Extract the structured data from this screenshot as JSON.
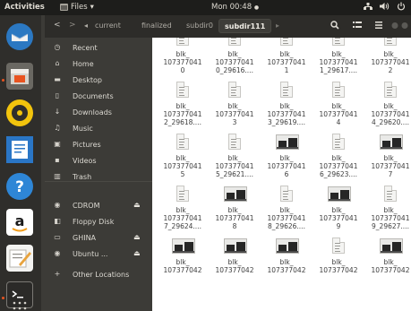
{
  "topbar": {
    "activities": "Activities",
    "app_menu": "Files",
    "app_menu_caret": "▾",
    "clock": "Mon 00:48",
    "clock_dot": "●",
    "tray": [
      "network-icon",
      "volume-icon",
      "power-icon"
    ]
  },
  "dock": {
    "items": [
      "thunderbird-icon",
      "files-icon",
      "rhythmbox-icon",
      "writer-icon",
      "help-icon",
      "amazon-icon",
      "text-editor-icon",
      "terminal-icon",
      "app-grid-icon"
    ]
  },
  "headerbar": {
    "back": "<",
    "forward": ">",
    "breadcrumb_left": "◂",
    "breadcrumbs": [
      "current",
      "finalized",
      "subdir0",
      "subdir111"
    ],
    "breadcrumb_right": "▸",
    "icons": [
      "search-icon",
      "list-view-icon",
      "menu-icon"
    ]
  },
  "sidebar": {
    "items": [
      {
        "label": "Recent",
        "icon": "recent-icon",
        "glyph": "◷"
      },
      {
        "label": "Home",
        "icon": "home-icon",
        "glyph": "⌂"
      },
      {
        "label": "Desktop",
        "icon": "desktop-icon",
        "glyph": "▬"
      },
      {
        "label": "Documents",
        "icon": "documents-icon",
        "glyph": "▯"
      },
      {
        "label": "Downloads",
        "icon": "downloads-icon",
        "glyph": "↓"
      },
      {
        "label": "Music",
        "icon": "music-icon",
        "glyph": "♫"
      },
      {
        "label": "Pictures",
        "icon": "pictures-icon",
        "glyph": "▣"
      },
      {
        "label": "Videos",
        "icon": "videos-icon",
        "glyph": "▪"
      },
      {
        "label": "Trash",
        "icon": "trash-icon",
        "glyph": "▥"
      },
      {
        "label": "CDROM",
        "icon": "cdrom-icon",
        "glyph": "◉",
        "eject": "⏏"
      },
      {
        "label": "Floppy Disk",
        "icon": "floppy-icon",
        "glyph": "◧"
      },
      {
        "label": "GHINA",
        "icon": "drive-icon",
        "glyph": "▭",
        "eject": "⏏"
      },
      {
        "label": "Ubuntu ...",
        "icon": "disc-icon",
        "glyph": "◉",
        "eject": "⏏"
      },
      {
        "label": "Other Locations",
        "icon": "plus-icon",
        "glyph": "+"
      }
    ]
  },
  "files": [
    {
      "l1": "blk_",
      "l2": "107377041",
      "l3": "0",
      "kind": "doc"
    },
    {
      "l1": "blk_",
      "l2": "107377041",
      "l3": "0_29616....",
      "kind": "doc"
    },
    {
      "l1": "blk_",
      "l2": "107377041",
      "l3": "1",
      "kind": "doc"
    },
    {
      "l1": "blk_",
      "l2": "107377041",
      "l3": "1_29617....",
      "kind": "doc"
    },
    {
      "l1": "blk_",
      "l2": "107377041",
      "l3": "2",
      "kind": "doc"
    },
    {
      "l1": "blk_",
      "l2": "107377041",
      "l3": "2_29618....",
      "kind": "doc"
    },
    {
      "l1": "blk_",
      "l2": "107377041",
      "l3": "3",
      "kind": "doc"
    },
    {
      "l1": "blk_",
      "l2": "107377041",
      "l3": "3_29619....",
      "kind": "doc"
    },
    {
      "l1": "blk_",
      "l2": "107377041",
      "l3": "4",
      "kind": "doc"
    },
    {
      "l1": "blk_",
      "l2": "107377041",
      "l3": "4_29620....",
      "kind": "doc"
    },
    {
      "l1": "blk_",
      "l2": "107377041",
      "l3": "5",
      "kind": "doc"
    },
    {
      "l1": "blk_",
      "l2": "107377041",
      "l3": "5_29621....",
      "kind": "doc"
    },
    {
      "l1": "blk_",
      "l2": "107377041",
      "l3": "6",
      "kind": "image"
    },
    {
      "l1": "blk_",
      "l2": "107377041",
      "l3": "6_29623....",
      "kind": "doc"
    },
    {
      "l1": "blk_",
      "l2": "107377041",
      "l3": "7",
      "kind": "image"
    },
    {
      "l1": "blk_",
      "l2": "107377041",
      "l3": "7_29624....",
      "kind": "doc"
    },
    {
      "l1": "blk_",
      "l2": "107377041",
      "l3": "8",
      "kind": "image"
    },
    {
      "l1": "blk_",
      "l2": "107377041",
      "l3": "8_29626....",
      "kind": "doc"
    },
    {
      "l1": "blk_",
      "l2": "107377041",
      "l3": "9",
      "kind": "image"
    },
    {
      "l1": "blk_",
      "l2": "107377041",
      "l3": "9_29627....",
      "kind": "doc"
    },
    {
      "l1": "blk_",
      "l2": "107377042",
      "l3": "",
      "kind": "image"
    },
    {
      "l1": "blk_",
      "l2": "107377042",
      "l3": "",
      "kind": "image"
    },
    {
      "l1": "blk_",
      "l2": "107377042",
      "l3": "",
      "kind": "image"
    },
    {
      "l1": "blk_",
      "l2": "107377042",
      "l3": "",
      "kind": "doc"
    },
    {
      "l1": "blk_",
      "l2": "107377042",
      "l3": "",
      "kind": "image"
    }
  ]
}
